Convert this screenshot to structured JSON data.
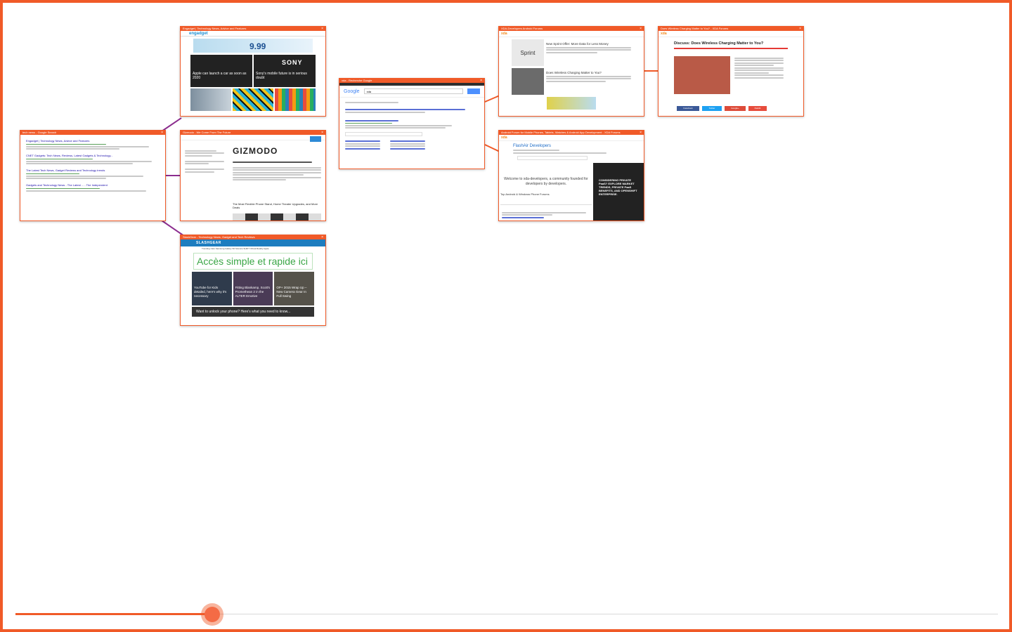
{
  "colors": {
    "accent": "#f05a28",
    "link_purple": "#8b2c8e"
  },
  "cards": {
    "google_tech": {
      "title": "tech news - Google Search",
      "results": [
        "Engadget | Technology News, Advice and Features",
        "CNET Gadgets: Tech News, Reviews, Latest Gadgets & Technology...",
        "The Latest Tech News, Gadget Reviews and Technology trends",
        "Gadgets and Technology News - The Latest ... - The Independent"
      ]
    },
    "engadget": {
      "title": "Engadget | Technology News, Advice and Features",
      "logo": "engadget",
      "ad_price": "9.99",
      "tile1": "Apple can launch a car as soon as 2020",
      "tile2_brand": "SONY",
      "tile2": "Sony's mobile future is in serious doubt"
    },
    "gizmodo": {
      "title": "Gizmodo - We Come From The Future",
      "logo": "GIZMODO",
      "headline": "The Most Flexible Phone Stand, Home Theater Upgrades, and More Deals"
    },
    "slashgear": {
      "title": "SlashGear - Technology News, Gadget and Tech Reviews",
      "logo": "SLASHGEAR",
      "nav": "Trending  Cars  Samsung Galaxy S6  Science  SHIFT  Virtual Reality  Apple",
      "ad_text": "Accès simple et rapide ici !",
      "tiles": [
        "YouTube for Kids detailed, here's why it's necessary",
        "Fitting Blankamp, Scott's Promethean 2 in the ALTER Emotive",
        "OP+ 2015 Wrap Up – New Camera Gear In Full Swing"
      ],
      "bar": "Want to unlock your phone? Here's what you need to know..."
    },
    "google_xda": {
      "title": "xda - Recherche Google",
      "logo": "Google",
      "query": "xda"
    },
    "xda_home": {
      "title": "XDA-Developers Android Forums",
      "logo": "xda",
      "item1_brand": "Sprint",
      "item1": "New Sprint Offer: More Data for Less Money",
      "item2": "Does Wireless Charging Matter to You?"
    },
    "xda_article": {
      "title": "Does Wireless Charging Matter to You? - XDA Forums",
      "logo": "xda",
      "headline": "Discuss: Does Wireless Charging Matter to You?",
      "share": [
        "Facebook",
        "Twitter",
        "Google+",
        "Reddit"
      ]
    },
    "xda_forum": {
      "title": "Android Forum for Mobile Phones, Tablets, Watches & Android App Development - XDA Forums",
      "logo": "xda",
      "forum_title": "FlashAir Developers",
      "welcome": "Welcome to xda-developers, a community founded for developers by developers.",
      "section": "Top Android & Windows Phone Forums",
      "ad": "CONSIDERING PRIVATE PaaS? EXPLORE MARKET TRENDS, PRIVATE PaaS BENEFITS, AND OPENSHIFT ENTERPRISE."
    }
  }
}
